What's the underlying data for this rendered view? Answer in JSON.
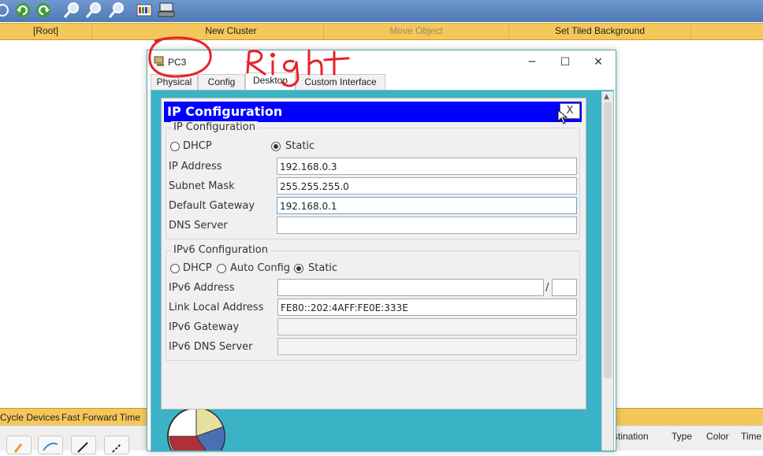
{
  "toolbar": {
    "icons": [
      "sync-icon",
      "undo-icon",
      "redo-icon",
      "zoom-in-icon",
      "zoom-reset-icon",
      "zoom-out-icon",
      "palette-icon",
      "device-icon"
    ]
  },
  "workspace_bar": {
    "root": "[Root]",
    "new_cluster": "New Cluster",
    "move_object": "Move Object",
    "set_background": "Set Tiled Background"
  },
  "bottom_bar": {
    "cycle_devices": "Cycle Devices",
    "fast_forward": "Fast Forward Time",
    "columns": [
      "stination",
      "Type",
      "Color",
      "Time"
    ]
  },
  "window": {
    "title": "PC3",
    "tabs": [
      "Physical",
      "Config",
      "Desktop",
      "Custom Interface"
    ],
    "active_tab": "Desktop",
    "controls": {
      "minimize": "─",
      "maximize": "☐",
      "close": "✕"
    }
  },
  "dialog": {
    "title": "IP Configuration",
    "close_label": "X",
    "ipv4": {
      "legend": "IP Configuration",
      "dhcp_label": "DHCP",
      "static_label": "Static",
      "mode": "static",
      "ip_label": "IP Address",
      "ip_value": "192.168.0.3",
      "mask_label": "Subnet Mask",
      "mask_value": "255.255.255.0",
      "gateway_label": "Default Gateway",
      "gateway_value": "192.168.0.1",
      "dns_label": "DNS Server",
      "dns_value": ""
    },
    "ipv6": {
      "legend": "IPv6 Configuration",
      "dhcp_label": "DHCP",
      "auto_label": "Auto Config",
      "static_label": "Static",
      "mode": "static",
      "address_label": "IPv6 Address",
      "address_value": "",
      "slash": "/",
      "prefix_value": "",
      "link_local_label": "Link Local Address",
      "link_local_value": "FE80::202:4AFF:FE0E:333E",
      "gateway_label": "IPv6 Gateway",
      "gateway_value": "",
      "dns_label": "IPv6 DNS Server",
      "dns_value": ""
    }
  },
  "annotation": {
    "handwritten_text": "Right",
    "color": "#e8202a"
  },
  "colors": {
    "toolbar": "#5b86c4",
    "workspace_bar": "#f4c75a",
    "desktop": "#3ab3c6",
    "dialog_title": "#0000ff"
  }
}
